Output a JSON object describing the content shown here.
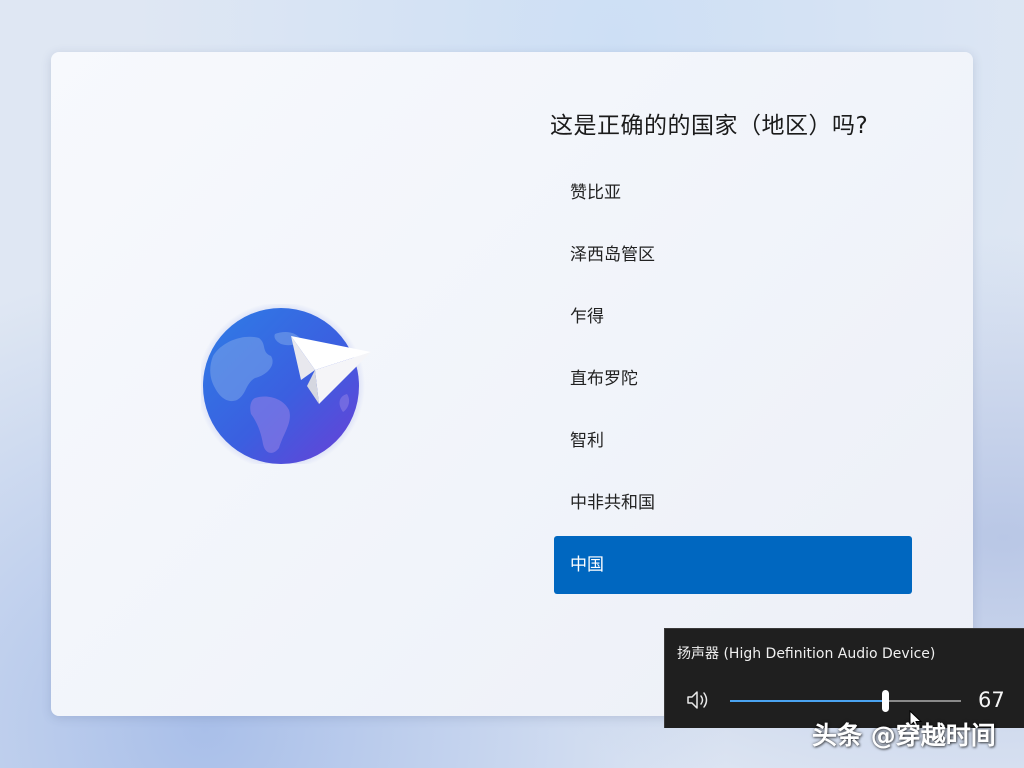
{
  "oobe": {
    "title": "这是正确的的国家（地区）吗?",
    "countries": [
      "赞比亚",
      "泽西岛管区",
      "乍得",
      "直布罗陀",
      "智利",
      "中非共和国",
      "中国"
    ],
    "selected_country": "中国",
    "accent_color": "#0067c0",
    "illustration": "globe-paper-plane-icon"
  },
  "volume_flyout": {
    "device_label": "扬声器 (High Definition Audio Device)",
    "volume": "67",
    "volume_fraction": 0.67,
    "icon": "speaker-icon"
  },
  "watermark": {
    "text": "头条 @穿越时间"
  }
}
